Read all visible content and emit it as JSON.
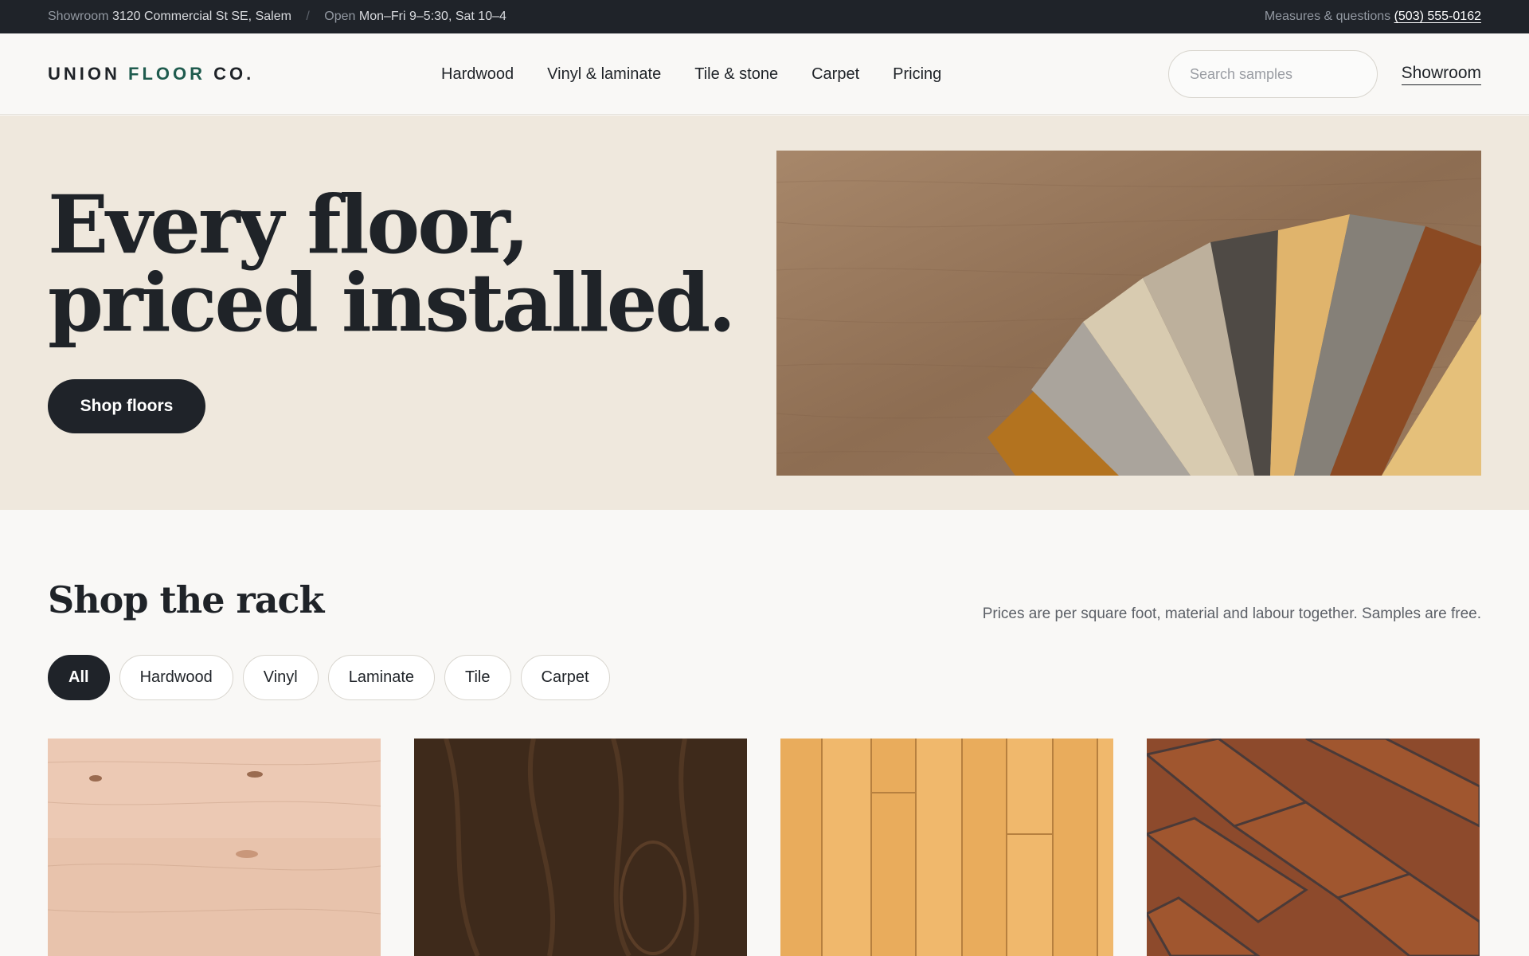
{
  "topbar": {
    "showroom_label": "Showroom",
    "address": "3120 Commercial St SE, Salem",
    "separator": "/",
    "open_label": "Open",
    "hours": "Mon–Fri 9–5:30, Sat 10–4",
    "contact_label": "Measures & questions",
    "phone": "(503) 555-0162"
  },
  "header": {
    "logo_part1": "UNION ",
    "logo_part2": "FLOOR",
    "logo_part3": " CO.",
    "nav": [
      "Hardwood",
      "Vinyl & laminate",
      "Tile & stone",
      "Carpet",
      "Pricing"
    ],
    "search_placeholder": "Search samples",
    "showroom_link": "Showroom"
  },
  "hero": {
    "headline": "Every floor,\npriced installed.",
    "cta": "Shop floors",
    "image": "floor-sample-fan-photo"
  },
  "rack": {
    "title": "Shop the rack",
    "note": "Prices are per square foot, material and labour together. Samples are free.",
    "filters": [
      "All",
      "Hardwood",
      "Vinyl",
      "Laminate",
      "Tile",
      "Carpet"
    ],
    "active_filter": "All",
    "cards": [
      "light-maple-texture",
      "dark-walnut-texture",
      "golden-oak-planks-texture",
      "herringbone-reddish-texture"
    ]
  },
  "colors": {
    "dark": "#1f2329",
    "accent": "#1f5b4e",
    "hero_bg": "#efe8dd",
    "page_bg": "#f9f8f6"
  }
}
